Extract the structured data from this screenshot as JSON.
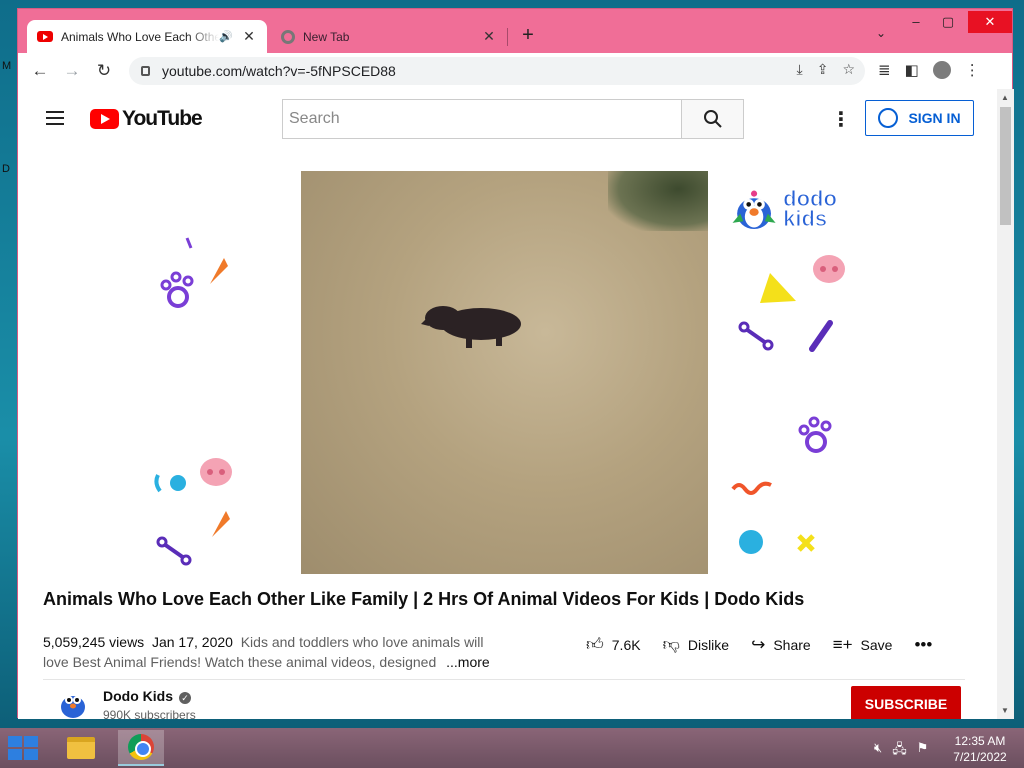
{
  "desktop": {
    "glyph_top": "M",
    "glyph_mid": "D"
  },
  "browser": {
    "tabs": [
      {
        "title": "Animals Who Love Each Other Like Family",
        "active": true,
        "audio": true
      },
      {
        "title": "New Tab",
        "active": false
      }
    ],
    "url": "youtube.com/watch?v=-5fNPSCED88",
    "window_controls": {
      "minimize": "–",
      "maximize": "▢",
      "close": "✕"
    }
  },
  "youtube": {
    "logo_text": "YouTube",
    "search_placeholder": "Search",
    "sign_in_label": "SIGN IN",
    "video": {
      "title": "Animals Who Love Each Other Like Family | 2 Hrs Of Animal Videos For Kids | Dodo Kids",
      "views": "5,059,245 views",
      "date": "Jan 17, 2020",
      "description": "Kids and toddlers who love animals will love Best Animal Friends! Watch these animal videos, designed",
      "more_label": "...more",
      "overlay_brand": "dodo kids",
      "actions": {
        "like_count": "7.6K",
        "dislike_label": "Dislike",
        "share_label": "Share",
        "save_label": "Save"
      }
    },
    "channel": {
      "name": "Dodo Kids",
      "subscribers": "990K subscribers",
      "subscribe_label": "SUBSCRIBE"
    }
  },
  "taskbar": {
    "time": "12:35 AM",
    "date": "7/21/2022"
  },
  "colors": {
    "window_frame": "#f06e97",
    "youtube_red": "#ff0000",
    "subscribe_red": "#cc0000",
    "link_blue": "#065fd4"
  }
}
